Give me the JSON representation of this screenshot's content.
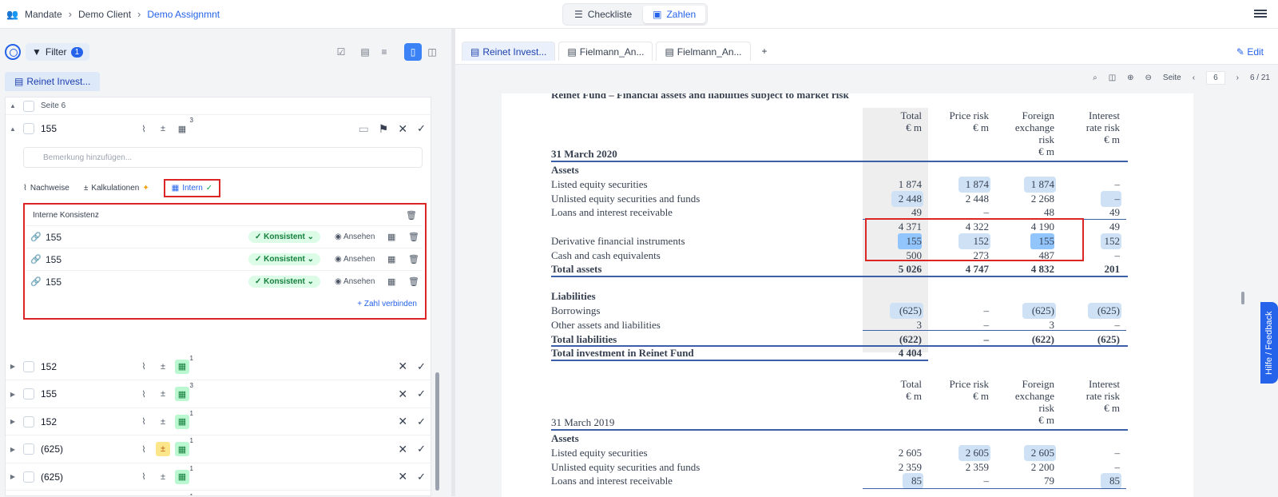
{
  "breadcrumb": [
    "Mandate",
    "Demo Client",
    "Demo Assignmnt"
  ],
  "mode_tabs": [
    "Checkliste",
    "Zahlen"
  ],
  "filter": {
    "label": "Filter",
    "count": "1"
  },
  "left_doc_tab": "Reinet Invest...",
  "page_group": "Seite 6",
  "expanded_item": {
    "label": "155",
    "count": "3",
    "comment_placeholder": "Bemerkung hinzufügen...",
    "subtabs": [
      "Nachweise",
      "Kalkulationen",
      "Intern"
    ],
    "konsistenz_title": "Interne Konsistenz",
    "rows": [
      {
        "value": "155",
        "status": "Konsistent",
        "view": "Ansehen"
      },
      {
        "value": "155",
        "status": "Konsistent",
        "view": "Ansehen"
      },
      {
        "value": "155",
        "status": "Konsistent",
        "view": "Ansehen"
      }
    ],
    "connect_label": "Zahl verbinden"
  },
  "list_items": [
    {
      "label": "152",
      "count": "1",
      "orange": false
    },
    {
      "label": "155",
      "count": "3",
      "orange": false
    },
    {
      "label": "152",
      "count": "1",
      "orange": false
    },
    {
      "label": "(625)",
      "count": "1",
      "orange": true
    },
    {
      "label": "(625)",
      "count": "1",
      "orange": false
    },
    {
      "label": "(625)",
      "count": "1",
      "orange": false
    }
  ],
  "doc_tabs": [
    "Reinet Invest...",
    "Fielmann_An...",
    "Fielmann_An..."
  ],
  "edit_label": "Edit",
  "viewer": {
    "page_label": "Seite",
    "page": "6",
    "page_of": "6 / 21"
  },
  "feedback_label": "Hilfe / Feedback",
  "doc": {
    "title": "Reinet Fund – Financial assets and liabilities subject to market risk",
    "headers": [
      "Total\n€ m",
      "Price risk\n€ m",
      "Foreign\nexchange\nrisk\n€ m",
      "Interest\nrate risk\n€ m"
    ],
    "date2020": "31 March 2020",
    "date2019": "31 March 2019",
    "assets_label": "Assets",
    "liab_label": "Liabilities",
    "rows2020": [
      {
        "label": "Listed equity securities",
        "v": [
          "1 874",
          "1 874",
          "1 874",
          "–"
        ]
      },
      {
        "label": "Unlisted equity securities and funds",
        "v": [
          "2 448",
          "2 448",
          "2 268",
          "–"
        ]
      },
      {
        "label": "Loans and interest receivable",
        "v": [
          "49",
          "–",
          "48",
          "49"
        ]
      },
      {
        "label": "",
        "v": [
          "4 371",
          "4 322",
          "4 190",
          "49"
        ]
      },
      {
        "label": "Derivative financial instruments",
        "v": [
          "155",
          "152",
          "155",
          "152"
        ]
      },
      {
        "label": "Cash and cash equivalents",
        "v": [
          "500",
          "273",
          "487",
          "–"
        ]
      },
      {
        "label": "Total assets",
        "v": [
          "5 026",
          "4 747",
          "4 832",
          "201"
        ]
      }
    ],
    "liab2020": [
      {
        "label": "Borrowings",
        "v": [
          "(625)",
          "–",
          "(625)",
          "(625)"
        ]
      },
      {
        "label": "Other assets and liabilities",
        "v": [
          "3",
          "–",
          "3",
          "–"
        ]
      },
      {
        "label": "Total liabilities",
        "v": [
          "(622)",
          "–",
          "(622)",
          "(625)"
        ]
      }
    ],
    "total_investment": {
      "label": "Total investment in Reinet Fund",
      "v": "4 404"
    },
    "rows2019": [
      {
        "label": "Listed equity securities",
        "v": [
          "2 605",
          "2 605",
          "2 605",
          "–"
        ]
      },
      {
        "label": "Unlisted equity securities and funds",
        "v": [
          "2 359",
          "2 359",
          "2 200",
          "–"
        ]
      },
      {
        "label": "Loans and interest receivable",
        "v": [
          "85",
          "–",
          "79",
          "85"
        ]
      }
    ]
  }
}
